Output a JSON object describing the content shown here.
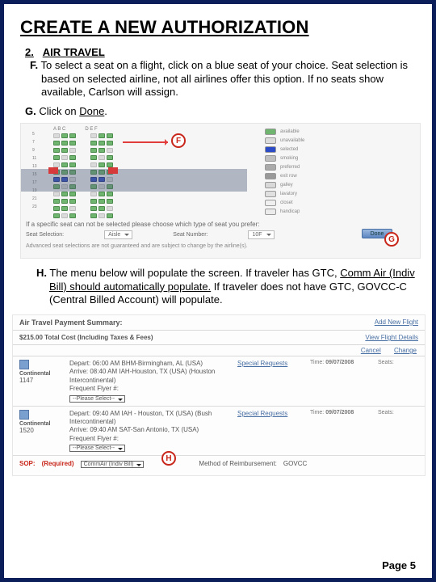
{
  "title": "CREATE A NEW AUTHORIZATION",
  "section_number": "2.",
  "section_label": "AIR TRAVEL",
  "item_f": {
    "letter": "F.",
    "text": "To select a seat on a flight, click on a blue seat of your choice. Seat selection is based on selected airline, not all airlines offer this option. If no seats show available, Carlson will assign."
  },
  "item_g": {
    "letter": "G.",
    "text_before": "Click on ",
    "done_word": "Done",
    "text_after": "."
  },
  "seat_figure": {
    "cols_left": "A B C",
    "cols_right": "D E F",
    "legend": [
      {
        "swatch": "#6fb56f",
        "label": "available"
      },
      {
        "swatch": "#dcdcdc",
        "label": "unavailable"
      },
      {
        "swatch": "#2b4cc6",
        "label": "selected"
      },
      {
        "swatch": "#c0c0c0",
        "label": "smoking"
      },
      {
        "swatch": "#aaaaaa",
        "label": "preferred"
      },
      {
        "swatch": "#999999",
        "label": "exit row"
      },
      {
        "swatch": "#d8d8d8",
        "label": "galley"
      },
      {
        "swatch": "#e0e0e0",
        "label": "lavatory"
      },
      {
        "swatch": "#efefef",
        "label": "closet"
      },
      {
        "swatch": "#ebebeb",
        "label": "handicap"
      }
    ],
    "prompt": "If a specific seat can not be selected please choose which type of seat you prefer:",
    "seat_selection_label": "Seat Selection:",
    "seat_selection_value": "Aisle",
    "seat_number_label": "Seat Number:",
    "seat_number_value": "10F",
    "done_button": "Done",
    "advance_note": "Advanced seat selections are not guaranteed and are subject to change by the airline(s).",
    "callout_f": "F",
    "callout_g": "G"
  },
  "item_h": {
    "letter": "H.",
    "text_before": "The menu below will populate the screen.  If traveler has GTC, ",
    "underlined": "Comm Air (Indiv Bill) should automatically populate.",
    "text_after": " If traveler does not have GTC, GOVCC-C (Central Billed Account) will populate."
  },
  "payment_figure": {
    "header": "Air Travel Payment Summary:",
    "add_link": "Add New Flight",
    "total_label": "$215.00 Total Cost (Including Taxes & Fees)",
    "flight_details_link": "View Flight Details",
    "cancel": "Cancel",
    "change": "Change",
    "flights": [
      {
        "airline": "Continental",
        "code": "1147",
        "depart": "Depart: 06:00 AM  BHM-Birmingham, AL (USA)",
        "arrive": "Arrive: 08:40 AM  IAH-Houston, TX (USA) (Houston Intercontinental)",
        "ff_label": "Frequent Flyer #:",
        "select": "--Please Select--",
        "special": "Special Requests",
        "time_label": "Time:",
        "time_value": "09/07/2008",
        "seats_label": "Seats:"
      },
      {
        "airline": "Continental",
        "code": "1520",
        "depart": "Depart: 09:40 AM  IAH - Houston, TX (USA) (Bush Intercontinental)",
        "arrive": "Arrive: 09:40 AM  SAT-San Antonio, TX (USA)",
        "ff_label": "Frequent Flyer #:",
        "select": "--Please Select--",
        "special": "Special Requests",
        "time_label": "Time:",
        "time_value": "09/07/2008",
        "seats_label": "Seats:"
      }
    ],
    "sop_label_prefix": "SOP:",
    "sop_required": "(Required)",
    "sop_value": "CommAir (Indiv Bill)",
    "method_label": "Method of Reimbursement:",
    "method_value": "GOVCC",
    "callout_h": "H"
  },
  "page_number": "Page 5"
}
